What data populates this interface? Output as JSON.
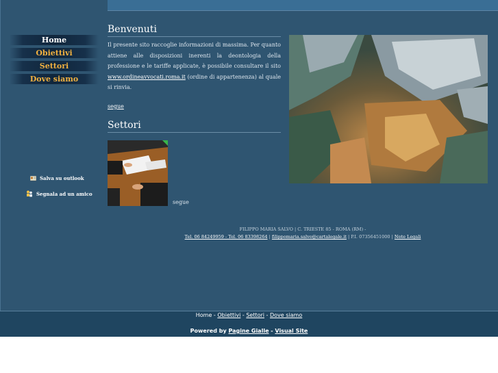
{
  "nav": {
    "items": [
      {
        "label": "Home",
        "active": true
      },
      {
        "label": "Obiettivi",
        "active": false
      },
      {
        "label": "Settori",
        "active": false
      },
      {
        "label": "Dove siamo",
        "active": false
      }
    ]
  },
  "side_links": {
    "outlook": "Salva su outlook",
    "friend": "Segnala ad un amico"
  },
  "welcome": {
    "title": "Benvenuti",
    "text_before": "Il presente sito raccoglie informazioni di massima. Per quanto attiene alle disposizioni inerenti la deontologia della professione e le tariffe applicate, è possibile consultare il sito ",
    "link": "www.ordineavvocati.roma.it",
    "text_after": " (ordine di appartenenza) al quale si rinvia.",
    "segue": "segue"
  },
  "sectors": {
    "title": "Settori",
    "segue": "segue"
  },
  "footer": {
    "line1": "FILIPPO MARIA SALVO | C. TRIESTE 85 - ROMA (RM) -",
    "phones": "Tel. 06 84249959 - Tel. 06 83398264",
    "sep1": " | ",
    "email": "filippomaria.salvo@cartalegale.it",
    "piva": " | P.I. 07356451000 | ",
    "legal": "Note Legali"
  },
  "bottom_nav": {
    "home": "Home",
    "sep": " - ",
    "obiettivi": "Obiettivi",
    "settori": "Settori",
    "dove": "Dove siamo"
  },
  "powered": {
    "prefix": "Powered by ",
    "pagine": "Pagine Gialle",
    "sep": " - ",
    "visual": "Visual Site"
  },
  "colors": {
    "background": "#2f5571",
    "nav_active": "#ffffff",
    "nav_inactive": "#f0b040"
  }
}
